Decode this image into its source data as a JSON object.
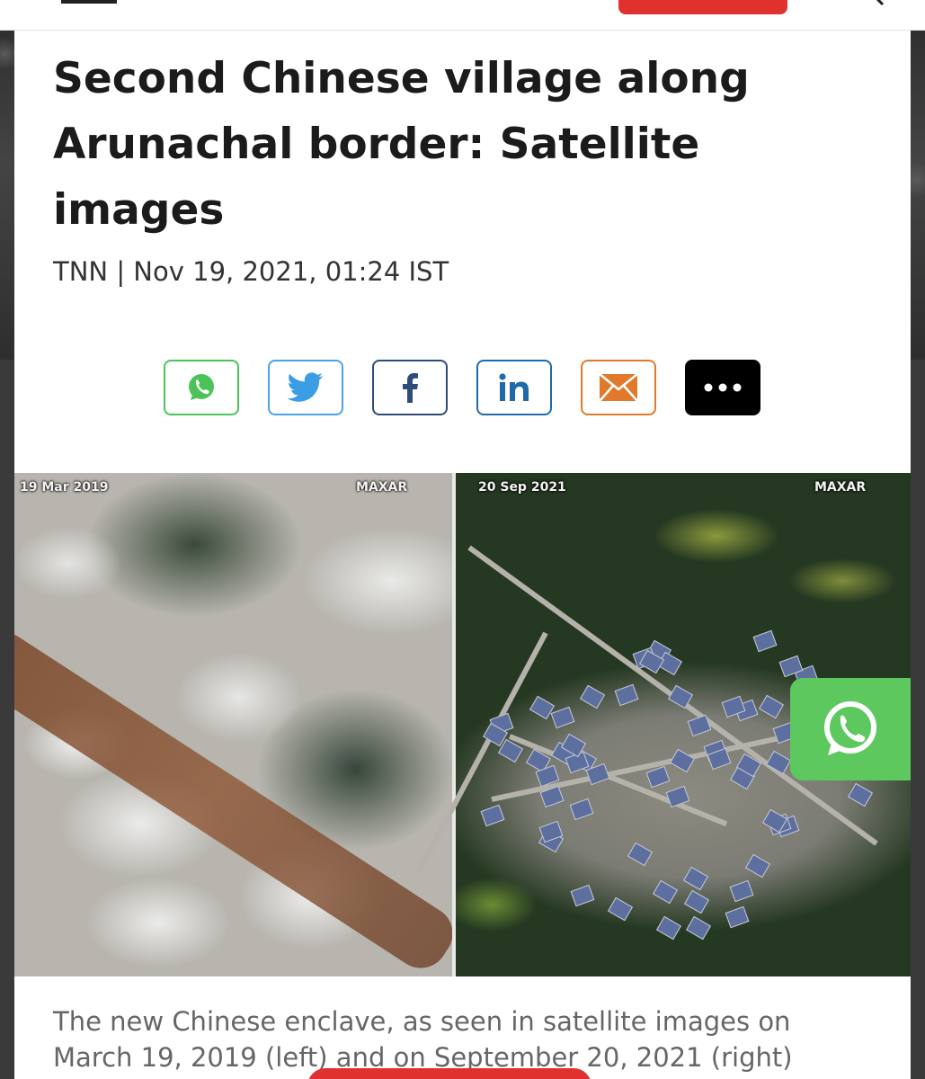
{
  "article": {
    "headline": "Second Chinese village along Arunachal border: Satellite images",
    "byline": "TNN | Nov 19, 2021, 01:24 IST",
    "image": {
      "left_date": "19 Mar 2019",
      "left_watermark": "MAXAR",
      "right_date": "20 Sep 2021",
      "right_watermark": "MAXAR"
    },
    "caption": "The new Chinese enclave, as seen in satellite images on March 19, 2019 (left) and on September 20, 2021 (right)"
  },
  "share": {
    "buttons": [
      {
        "icon": "whatsapp-icon",
        "color": "#4cc35a"
      },
      {
        "icon": "twitter-icon",
        "color": "#4aa3e8"
      },
      {
        "icon": "facebook-icon",
        "color": "#2f4b7c"
      },
      {
        "icon": "linkedin-icon",
        "color": "#1f6aa8"
      },
      {
        "icon": "email-icon",
        "color": "#e07a2a"
      },
      {
        "icon": "more-icon",
        "color": "#000000"
      }
    ]
  },
  "floating": {
    "icon": "whatsapp-icon",
    "color": "#5cc85e"
  },
  "colors": {
    "accent_red": "#e0312f"
  }
}
